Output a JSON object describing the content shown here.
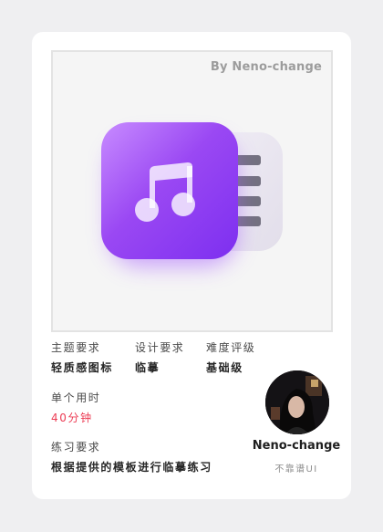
{
  "preview": {
    "by_line": "By Neno-change",
    "icon": "music-folder-icon",
    "colors": {
      "accent_purple": "#8f3ff0",
      "accent_light": "#c37dff",
      "tab_gray": "#73717f"
    }
  },
  "details": {
    "theme": {
      "label": "主题要求",
      "value": "轻质感图标"
    },
    "design": {
      "label": "设计要求",
      "value": "临摹"
    },
    "difficulty": {
      "label": "难度评级",
      "value": "基础级"
    },
    "time": {
      "label": "单个用时",
      "value": "40分钟"
    },
    "practice": {
      "label": "练习要求",
      "value": "根据提供的模板进行临摹练习"
    }
  },
  "author": {
    "name": "Neno-change",
    "subtitle": "不靠谱UI"
  }
}
